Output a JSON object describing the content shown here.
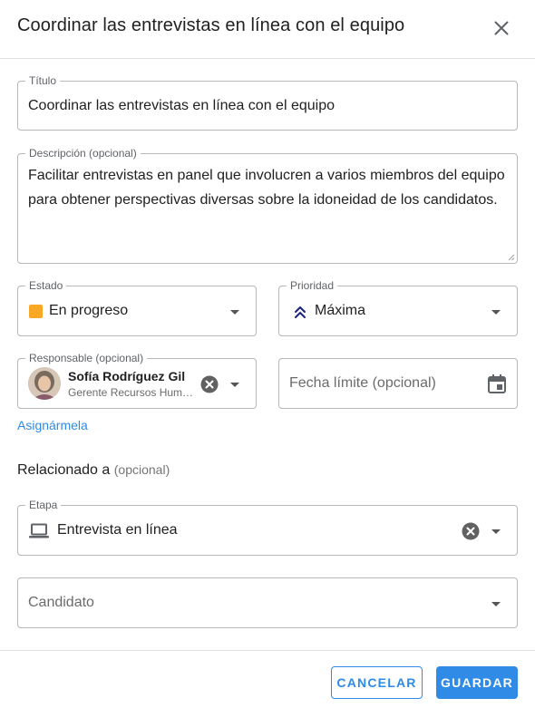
{
  "dialog": {
    "title": "Coordinar las entrevistas en línea con el equipo"
  },
  "form": {
    "title_field": {
      "label": "Título",
      "value": "Coordinar las entrevistas en línea con el equipo"
    },
    "description_field": {
      "label": "Descripción (opcional)",
      "value": "Facilitar entrevistas en panel que involucren a varios miembros del equipo para obtener perspectivas diversas sobre la idoneidad de los candidatos."
    },
    "status_field": {
      "label": "Estado",
      "value": "En progreso",
      "color": "#f9a825"
    },
    "priority_field": {
      "label": "Prioridad",
      "value": "Máxima",
      "icon": "double-chevron-up-icon",
      "icon_color": "#1a237e"
    },
    "assignee_field": {
      "label": "Responsable (opcional)",
      "name": "Sofía Rodríguez Gil",
      "role": "Gerente Recursos Humanos"
    },
    "due_date_field": {
      "placeholder": "Fecha límite (opcional)",
      "icon": "calendar-icon"
    },
    "assign_to_me_link": "Asignármela",
    "related_section": {
      "title": "Relacionado a",
      "optional_suffix": "(opcional)"
    },
    "stage_field": {
      "label": "Etapa",
      "value": "Entrevista en línea",
      "icon": "laptop-icon"
    },
    "candidate_field": {
      "placeholder": "Candidato"
    }
  },
  "footer": {
    "cancel_label": "CANCELAR",
    "save_label": "GUARDAR"
  },
  "colors": {
    "accent": "#2f8be6",
    "border": "#b8b8b8"
  }
}
